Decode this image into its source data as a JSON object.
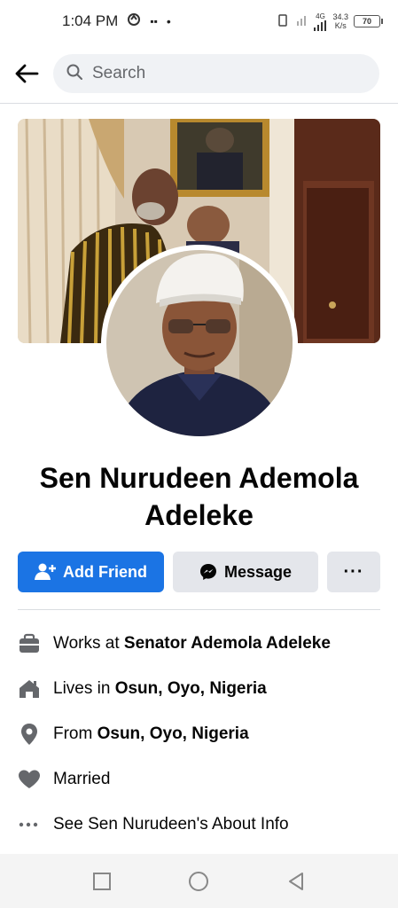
{
  "status_bar": {
    "time": "1:04 PM",
    "network": "4G",
    "speed_value": "34.3",
    "speed_unit": "K/s",
    "battery": "70"
  },
  "search": {
    "placeholder": "Search"
  },
  "profile": {
    "name_line1": "Sen Nurudeen Ademola",
    "name_line2": "Adeleke"
  },
  "actions": {
    "add_friend": "Add Friend",
    "message": "Message",
    "more": "···"
  },
  "info": {
    "work_prefix": "Works at ",
    "work_value": "Senator Ademola Adeleke",
    "lives_prefix": "Lives in ",
    "lives_value": "Osun, Oyo, Nigeria",
    "from_prefix": "From ",
    "from_value": "Osun, Oyo, Nigeria",
    "relationship": "Married",
    "about_link": "See Sen Nurudeen's About Info"
  },
  "colors": {
    "primary": "#1b74e4",
    "secondary_bg": "#e4e6eb",
    "icon_gray": "#65676b"
  }
}
